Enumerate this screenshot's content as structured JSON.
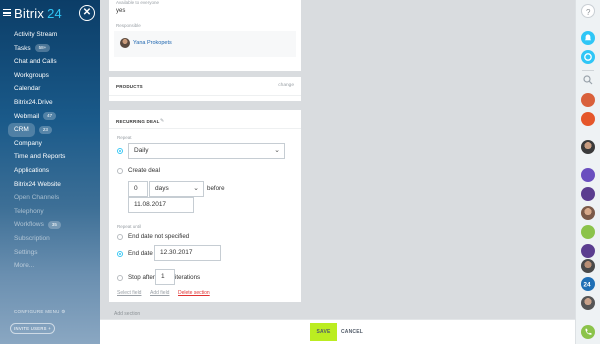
{
  "sidebar": {
    "logo": "Bitrix",
    "logo_num": "24",
    "items": [
      {
        "label": "Activity Stream",
        "badge": ""
      },
      {
        "label": "Tasks",
        "badge": "58+"
      },
      {
        "label": "Chat and Calls",
        "badge": ""
      },
      {
        "label": "Workgroups",
        "badge": ""
      },
      {
        "label": "Calendar",
        "badge": ""
      },
      {
        "label": "Bitrix24.Drive",
        "badge": ""
      },
      {
        "label": "Webmail",
        "badge": "47"
      },
      {
        "label": "CRM",
        "badge": "23"
      },
      {
        "label": "Company",
        "badge": ""
      },
      {
        "label": "Time and Reports",
        "badge": ""
      },
      {
        "label": "Applications",
        "badge": ""
      },
      {
        "label": "Bitrix24 Website",
        "badge": ""
      },
      {
        "label": "Open Channels",
        "badge": ""
      },
      {
        "label": "Telephony",
        "badge": ""
      },
      {
        "label": "Workflows",
        "badge": "35"
      },
      {
        "label": "Subscription",
        "badge": ""
      },
      {
        "label": "Settings",
        "badge": ""
      },
      {
        "label": "More...",
        "badge": ""
      }
    ],
    "configure": "CONFIGURE MENU",
    "invite": "INVITE USERS"
  },
  "card1": {
    "available_label": "Available to everyone",
    "available_value": "yes",
    "responsible_label": "Responsible",
    "responsible_name": "Yana Prokopets"
  },
  "products": {
    "title": "PRODUCTS",
    "change": "change"
  },
  "recurring": {
    "title": "RECURRING DEAL",
    "repeat_label": "Repeat",
    "repeat_value": "Daily",
    "create_deal": "Create deal",
    "offset_value": "0",
    "offset_unit": "days",
    "before": "before",
    "date_value": "11.08.2017",
    "repeat_until_label": "Repeat until",
    "end_not_specified": "End date not specified",
    "end_date_label": "End date",
    "end_date_value": "12.30.2017",
    "stop_after_label": "Stop after",
    "stop_after_value": "1",
    "iterations": "iterations",
    "select_field": "Select field",
    "add_field": "Add field",
    "delete_section": "Delete section"
  },
  "add_section": "Add section",
  "footer": {
    "save": "SAVE",
    "cancel": "CANCEL"
  },
  "colors": {
    "accent": "#3bc8f5",
    "save_green": "#bbed21",
    "link_blue": "#2067b0",
    "delete_red": "#e03232"
  }
}
